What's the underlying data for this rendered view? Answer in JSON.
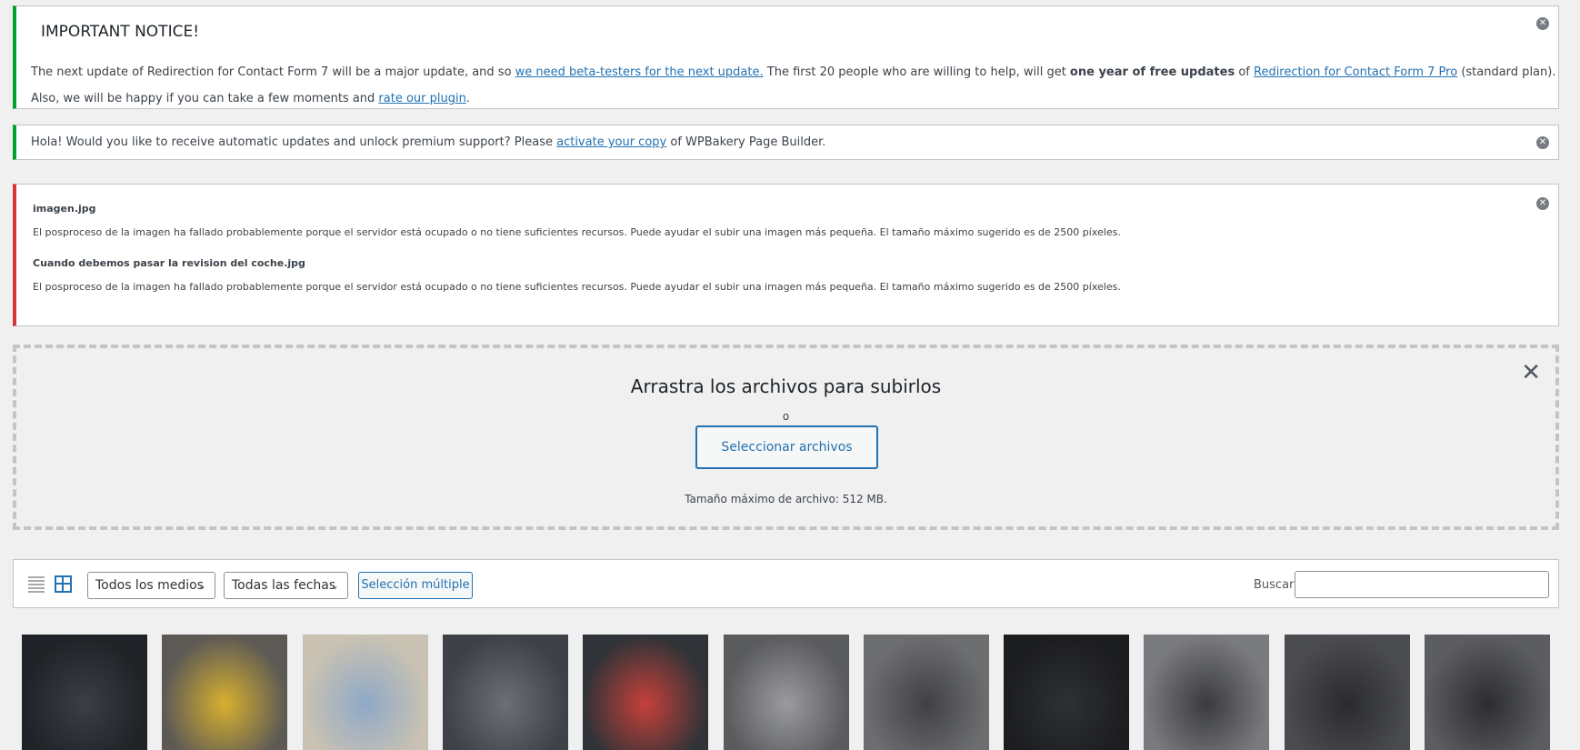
{
  "notices": {
    "important": {
      "title": "IMPORTANT NOTICE!",
      "p1_a": "The next update of Redirection for Contact Form 7 will be a major update, and so ",
      "p1_link1": "we need beta-testers for the next update.",
      "p1_b": " The first 20 people who are willing to help, will get ",
      "p1_bold": "one year of free updates",
      "p1_c": " of ",
      "p1_link2": "Redirection for Contact Form 7 Pro",
      "p1_d": " (standard plan).",
      "p2_a": "Also, we will be happy if you can take a few moments and ",
      "p2_link": "rate our plugin",
      "p2_b": "."
    },
    "wpbakery": {
      "a": "Hola! Would you like to receive automatic updates and unlock premium support? Please ",
      "link": "activate your copy",
      "b": " of WPBakery Page Builder."
    },
    "errors": {
      "file1": "imagen.jpg",
      "msg1": "El posproceso de la imagen ha fallado probablemente porque el servidor está ocupado o no tiene suficientes recursos. Puede ayudar el subir una imagen más pequeña. El tamaño máximo sugerido es de 2500 píxeles.",
      "file2": "Cuando debemos pasar la revision del coche.jpg",
      "msg2": "El posproceso de la imagen ha fallado probablemente porque el servidor está ocupado o no tiene suficientes recursos. Puede ayudar el subir una imagen más pequeña. El tamaño máximo sugerido es de 2500 píxeles."
    },
    "dismiss_icon": "⊗"
  },
  "uploader": {
    "drop_text": "Arrastra los archivos para subirlos",
    "or_text": "o",
    "select_label": "Seleccionar archivos",
    "max_size": "Tamaño máximo de archivo: 512 MB.",
    "close_glyph": "✕"
  },
  "toolbar": {
    "type_filter": "Todos los medios",
    "date_filter": "Todas las fechas",
    "multi_select": "Selección múltiple",
    "search_label": "Buscar",
    "chevron": "⌄"
  },
  "thumbnails": [
    {
      "name": "thumb-dashboard-gauges",
      "bg": "#1f2226",
      "accent": "#3b3e44"
    },
    {
      "name": "thumb-reverse-camera",
      "bg": "#5d5a55",
      "accent": "#d7b02f"
    },
    {
      "name": "thumb-navigation-map",
      "bg": "#c9c2b2",
      "accent": "#8fa9c7"
    },
    {
      "name": "thumb-infotainment-menu",
      "bg": "#3e4246",
      "accent": "#6c7076"
    },
    {
      "name": "thumb-infotainment-apps",
      "bg": "#303337",
      "accent": "#c6403a"
    },
    {
      "name": "thumb-center-console",
      "bg": "#5a5b5d",
      "accent": "#9a9b9e"
    },
    {
      "name": "thumb-climate-controls",
      "bg": "#6d6e70",
      "accent": "#404144"
    },
    {
      "name": "thumb-usb-ports",
      "bg": "#1c1d1f",
      "accent": "#2e3033"
    },
    {
      "name": "thumb-drive-buttons",
      "bg": "#7a7b7e",
      "accent": "#3a3b3e"
    },
    {
      "name": "thumb-steering-left",
      "bg": "#4b4c4f",
      "accent": "#2a2b2d"
    },
    {
      "name": "thumb-steering-right",
      "bg": "#5c5d60",
      "accent": "#2c2d30"
    }
  ]
}
